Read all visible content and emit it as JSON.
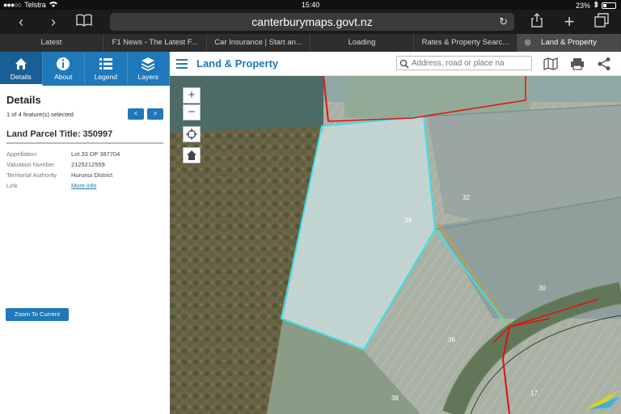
{
  "status": {
    "carrier": "Telstra",
    "time": "15:40",
    "battery": "23%"
  },
  "browser": {
    "url": "canterburymaps.govt.nz"
  },
  "tabs": [
    {
      "label": "Latest"
    },
    {
      "label": "F1 News - The Latest F..."
    },
    {
      "label": "Car Insurance | Start an..."
    },
    {
      "label": "Loading"
    },
    {
      "label": "Rates & Property Searc..."
    },
    {
      "label": "Land & Property"
    }
  ],
  "panel": {
    "tabs": [
      {
        "label": "Details",
        "icon": "home-icon"
      },
      {
        "label": "About",
        "icon": "info-icon"
      },
      {
        "label": "Legend",
        "icon": "list-icon"
      },
      {
        "label": "Layers",
        "icon": "layers-icon"
      }
    ],
    "title": "Details",
    "count": "1 of 4 feature(s) selected",
    "prev": "<",
    "next": ">",
    "parcel_title": "Land Parcel Title: 350997",
    "attributes": [
      {
        "key": "Appellation",
        "value": "Lot 33 DP 387704"
      },
      {
        "key": "Valuation Number",
        "value": "2125212559"
      },
      {
        "key": "Territorial Authority",
        "value": "Hurunui District"
      },
      {
        "key": "Link",
        "value": "More info"
      }
    ],
    "zoom_button": "Zoom To Current"
  },
  "app": {
    "title": "Land & Property",
    "search_placeholder": "Address, road or place na"
  },
  "map": {
    "zoom_in": "+",
    "zoom_out": "−",
    "parcel_labels": [
      "32",
      "34",
      "30",
      "36",
      "38",
      "17"
    ]
  },
  "colors": {
    "accent": "#1f78b9",
    "parcel_outline": "#3ee0e8",
    "boundary": "#e01010"
  }
}
